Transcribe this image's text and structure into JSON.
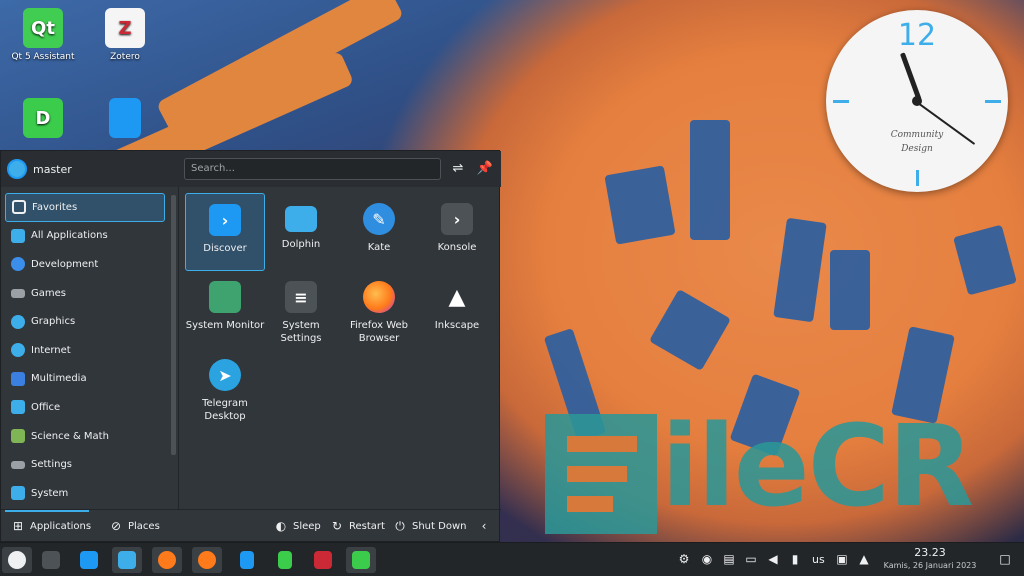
{
  "desktop": {
    "icons": [
      {
        "label": "Qt 5 Assistant",
        "glyph": "Qt",
        "color": "#41cd52"
      },
      {
        "label": "Zotero",
        "glyph": "Z",
        "color": "#cc2936"
      },
      {
        "label": "",
        "glyph": "D",
        "color": "#3bcc4c"
      },
      {
        "label": "",
        "glyph": "",
        "color": "#1d99f3"
      }
    ]
  },
  "clock_widget": {
    "numeral": "12",
    "brand_line1": "Community",
    "brand_line2": "Design"
  },
  "watermark": {
    "text": "ileCR"
  },
  "launcher": {
    "user": "master",
    "search_placeholder": "Search...",
    "categories": [
      {
        "label": "Favorites",
        "icon": "bookmark-icon",
        "color": "#eff0f1"
      },
      {
        "label": "All Applications",
        "icon": "grid-icon",
        "color": "#3daee9"
      },
      {
        "label": "Development",
        "icon": "development-icon",
        "color": "#3b8ee9"
      },
      {
        "label": "Games",
        "icon": "gamepad-icon",
        "color": "#9aa0a6"
      },
      {
        "label": "Graphics",
        "icon": "graphics-icon",
        "color": "#3daee9"
      },
      {
        "label": "Internet",
        "icon": "globe-icon",
        "color": "#3daee9"
      },
      {
        "label": "Multimedia",
        "icon": "multimedia-icon",
        "color": "#3b7fe0"
      },
      {
        "label": "Office",
        "icon": "office-icon",
        "color": "#3daee9"
      },
      {
        "label": "Science & Math",
        "icon": "science-icon",
        "color": "#7fb554"
      },
      {
        "label": "Settings",
        "icon": "settings-icon",
        "color": "#9aa0a6"
      },
      {
        "label": "System",
        "icon": "system-icon",
        "color": "#3daee9"
      }
    ],
    "apps": [
      {
        "label": "Discover",
        "icon": "discover-icon",
        "color": "#1d99f3"
      },
      {
        "label": "Dolphin",
        "icon": "folder-icon",
        "color": "#3daee9"
      },
      {
        "label": "Kate",
        "icon": "kate-icon",
        "color": "#2f8ee0"
      },
      {
        "label": "Konsole",
        "icon": "terminal-icon",
        "color": "#4d5257"
      },
      {
        "label": "System Monitor",
        "icon": "system-monitor-icon",
        "color": "#3ea36e"
      },
      {
        "label": "System Settings",
        "icon": "system-settings-icon",
        "color": "#4d5257"
      },
      {
        "label": "Firefox Web Browser",
        "icon": "firefox-icon",
        "color": "#ff7a1a"
      },
      {
        "label": "Inkscape",
        "icon": "inkscape-icon",
        "color": "#31363b"
      },
      {
        "label": "Telegram Desktop",
        "icon": "telegram-icon",
        "color": "#2aa3e0"
      }
    ],
    "footer": {
      "applications": "Applications",
      "places": "Places",
      "sleep": "Sleep",
      "restart": "Restart",
      "shutdown": "Shut Down"
    }
  },
  "taskbar": {
    "layout": "us",
    "time": "23.23",
    "date": "Kamis, 26 Januari 2023"
  }
}
